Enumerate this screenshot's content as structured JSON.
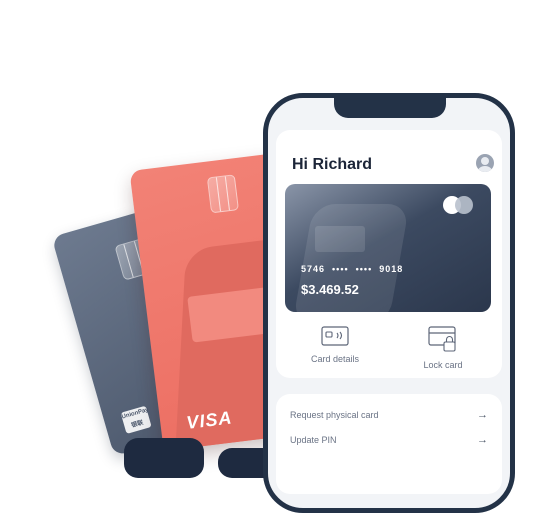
{
  "home": {
    "greeting": "Hi Richard",
    "card": {
      "number_display": "5746  ••••  ••••  9018",
      "balance": "$3.469.52",
      "network": "mastercard"
    },
    "actions": [
      {
        "label": "Card details",
        "icon": "card-details-icon"
      },
      {
        "label": "Lock card",
        "icon": "lock-card-icon"
      }
    ],
    "list": [
      {
        "label": "Request physical card",
        "arrow": "→"
      },
      {
        "label": "Update PIN",
        "arrow": "→"
      }
    ]
  },
  "background_cards": {
    "coral": {
      "brand": "VISA",
      "color": "#ef7a6e"
    },
    "grey": {
      "brand_lines": [
        "UnionPay",
        "银联"
      ],
      "color": "#5e6a7e"
    }
  },
  "colors": {
    "phone_frame": "#233247",
    "text_dark": "#1c2538",
    "text_muted": "#6a7385"
  }
}
